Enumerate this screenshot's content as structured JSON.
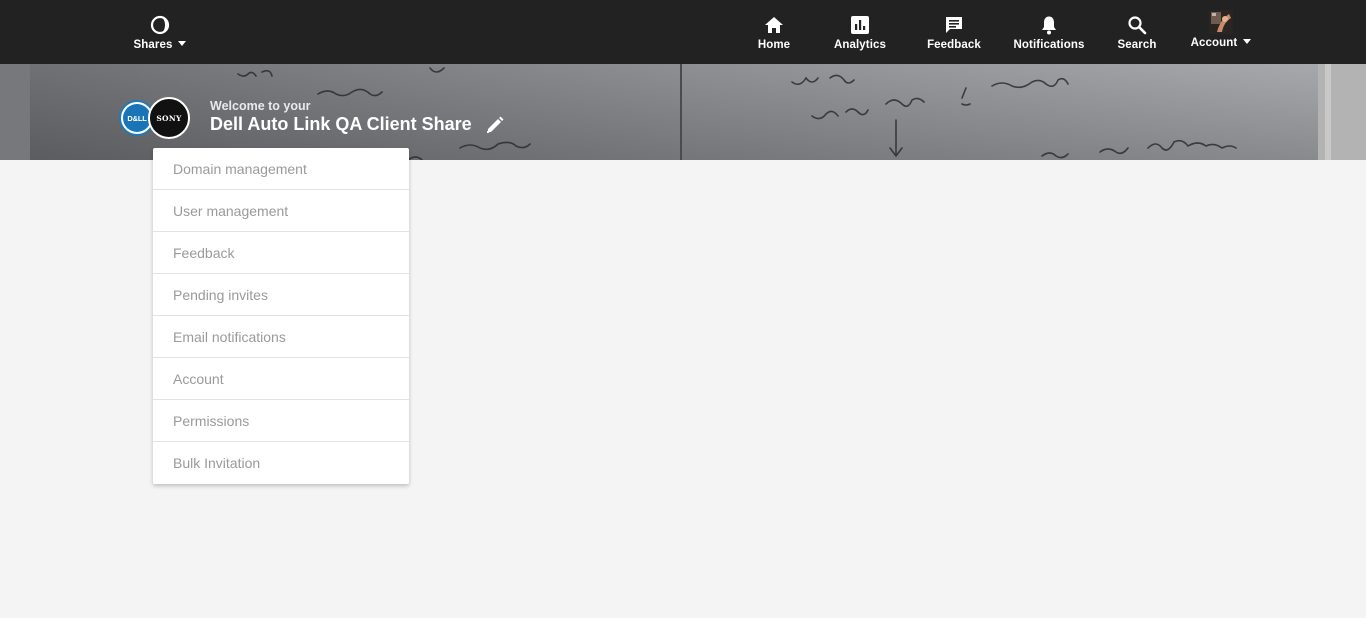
{
  "header": {
    "shares_label": "Shares",
    "nav": [
      {
        "label": "Home",
        "icon": "home-icon"
      },
      {
        "label": "Analytics",
        "icon": "analytics-icon"
      },
      {
        "label": "Feedback",
        "icon": "feedback-icon"
      },
      {
        "label": "Notifications",
        "icon": "bell-icon"
      },
      {
        "label": "Search",
        "icon": "search-icon"
      }
    ],
    "account_label": "Account"
  },
  "banner": {
    "welcome_text": "Welcome to your",
    "share_title": "Dell Auto Link QA Client Share",
    "logos": {
      "dell": "D&LL",
      "sony": "SONY"
    }
  },
  "menu": {
    "items": [
      "Domain management",
      "User management",
      "Feedback",
      "Pending invites",
      "Email notifications",
      "Account",
      "Permissions",
      "Bulk Invitation"
    ]
  },
  "colors": {
    "topbar": "#222222",
    "page_background": "#f4f4f4",
    "menu_text": "#9a9a9a",
    "dell_blue": "#1a75b8"
  }
}
